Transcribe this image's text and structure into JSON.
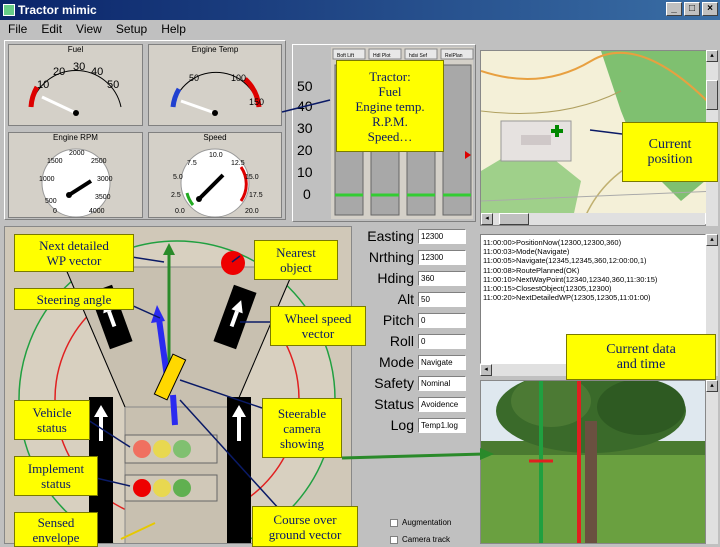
{
  "window": {
    "title": "Tractor mimic",
    "controls": [
      "_",
      "□",
      "×"
    ]
  },
  "menu": [
    {
      "label": "File"
    },
    {
      "label": "Edit"
    },
    {
      "label": "View"
    },
    {
      "label": "Setup"
    },
    {
      "label": "Help"
    }
  ],
  "gauges": {
    "fuel": {
      "title": "Fuel",
      "ticks": [
        "10",
        "20",
        "30",
        "40",
        "50"
      ]
    },
    "engine_temp": {
      "title": "Engine Temp",
      "ticks": [
        "50",
        "100",
        "150"
      ]
    },
    "engine_rpm": {
      "title": "Engine RPM",
      "ticks": [
        "500",
        "1000",
        "1500",
        "2000",
        "2500",
        "3000",
        "3500",
        "4000",
        "0"
      ]
    },
    "speed": {
      "title": "Speed",
      "ticks": [
        "0.0",
        "2.5",
        "5.0",
        "7.5",
        "10.0",
        "12.5",
        "15.0",
        "17.5",
        "20.0"
      ]
    }
  },
  "bar_panel": {
    "headers": [
      "Boft Lift",
      "Hdl Plot",
      "hdsi Sef",
      "RelPlan"
    ],
    "ticks": [
      "50",
      "40",
      "30",
      "20",
      "10",
      "0"
    ]
  },
  "fields": [
    {
      "label": "Easting",
      "value": "12300"
    },
    {
      "label": "Nrthing",
      "value": "12300"
    },
    {
      "label": "Hding",
      "value": "360"
    },
    {
      "label": "Alt",
      "value": "50"
    },
    {
      "label": "Pitch",
      "value": "0"
    },
    {
      "label": "Roll",
      "value": "0"
    },
    {
      "label": "Mode",
      "value": "Navigate"
    },
    {
      "label": "Safety",
      "value": "Nominal"
    },
    {
      "label": "Status",
      "value": "Avoidence"
    },
    {
      "label": "Log",
      "value": "Temp1.log"
    }
  ],
  "log": [
    "11:00:00>PositionNow(12300,12300,360)",
    "11:00:03>Mode(Navigate)",
    "11:00:05>Navigate(12345,12345,360,12:00:00,1)",
    "11:00:08>RoutePlanned(OK)",
    "11:00:10>NextWayPoint(12340,12340,360,11:30:15)",
    "11:00:15>ClosestObject(12305,12300)",
    "11:00:20>NextDetailedWP(12305,12305,11:01:00)"
  ],
  "checkboxes": [
    {
      "label": "Augmentation"
    },
    {
      "label": "Camera track"
    }
  ],
  "callouts": {
    "tractor": "Tractor:\nFuel\nEngine temp.\nR.P.M.\nSpeed…",
    "current_position": "Current\nposition",
    "next_wp": "Next detailed\nWP vector",
    "nearest": "Nearest\nobject",
    "steering": "Steering angle",
    "wheel_speed": "Wheel speed\nvector",
    "current_data": "Current data\nand time",
    "vehicle_status": "Vehicle\nstatus",
    "steerable_camera": "Steerable\ncamera\nshowing",
    "implement_status": "Implement\nstatus",
    "sensed_envelope": "Sensed\nenvelope",
    "course_over_ground": "Course over\nground vector"
  },
  "colors": {
    "callout_bg": "#ffff00",
    "callout_text": "#0a1a66",
    "arrow": "#2a8a2a",
    "ring_red": "#e02020",
    "ring_green": "#20a040"
  }
}
